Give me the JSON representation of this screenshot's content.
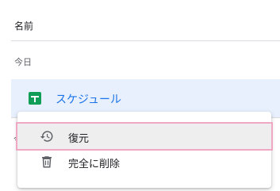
{
  "list": {
    "header_label": "名前",
    "section_label": "今日",
    "under_glyph": "今"
  },
  "file": {
    "name": "スケジュール",
    "icon": "google-sheets-icon",
    "name_color": "#1a73e8",
    "icon_color": "#0f9d58"
  },
  "context_menu": {
    "items": [
      {
        "label": "復元",
        "icon": "restore-history-icon",
        "highlighted": true
      },
      {
        "label": "完全に削除",
        "icon": "trash-icon",
        "highlighted": false
      }
    ],
    "highlight_color": "#f0a7c2"
  }
}
